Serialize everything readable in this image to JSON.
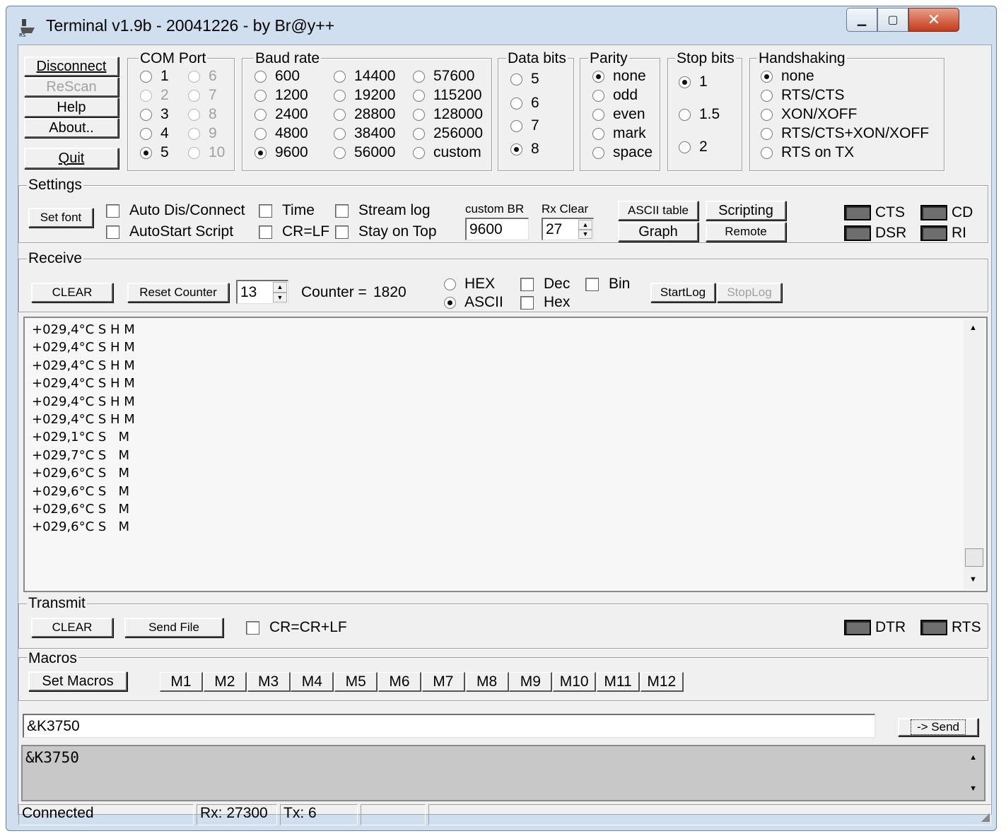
{
  "window": {
    "title": "Terminal v1.9b - 20041226 - by Br@y++",
    "minimize": "▁",
    "maximize": "▢",
    "close": "✕"
  },
  "connection_buttons": {
    "disconnect": "Disconnect",
    "rescan": "ReScan",
    "help": "Help",
    "about": "About..",
    "quit": "Quit"
  },
  "com_port": {
    "label": "COM Port",
    "options": [
      "1",
      "2",
      "3",
      "4",
      "5",
      "6",
      "7",
      "8",
      "9",
      "10"
    ],
    "selected": "5"
  },
  "baud_rate": {
    "label": "Baud rate",
    "options": [
      "600",
      "1200",
      "2400",
      "4800",
      "9600",
      "14400",
      "19200",
      "28800",
      "38400",
      "56000",
      "57600",
      "115200",
      "128000",
      "256000",
      "custom"
    ],
    "selected": "9600"
  },
  "data_bits": {
    "label": "Data bits",
    "options": [
      "5",
      "6",
      "7",
      "8"
    ],
    "selected": "8"
  },
  "parity": {
    "label": "Parity",
    "options": [
      "none",
      "odd",
      "even",
      "mark",
      "space"
    ],
    "selected": "none"
  },
  "stop_bits": {
    "label": "Stop bits",
    "options": [
      "1",
      "1.5",
      "2"
    ],
    "selected": "1"
  },
  "handshaking": {
    "label": "Handshaking",
    "options": [
      "none",
      "RTS/CTS",
      "XON/XOFF",
      "RTS/CTS+XON/XOFF",
      "RTS on TX"
    ],
    "selected": "none"
  },
  "settings": {
    "label": "Settings",
    "set_font": "Set font",
    "auto_dis_connect": "Auto Dis/Connect",
    "autostart_script": "AutoStart Script",
    "time": "Time",
    "cr_lf": "CR=LF",
    "stream_log": "Stream log",
    "stay_on_top": "Stay on Top",
    "custom_br_label": "custom BR",
    "custom_br_value": "9600",
    "rx_clear_label": "Rx Clear",
    "rx_clear_value": "27",
    "ascii_table": "ASCII table",
    "scripting": "Scripting",
    "graph": "Graph",
    "remote": "Remote",
    "leds": {
      "cts": "CTS",
      "cd": "CD",
      "dsr": "DSR",
      "ri": "RI"
    }
  },
  "receive": {
    "label": "Receive",
    "clear": "CLEAR",
    "reset_counter": "Reset Counter",
    "counter_spin": "13",
    "counter_label": "Counter =",
    "counter_value": "1820",
    "hex": "HEX",
    "ascii": "ASCII",
    "mode_selected": "ASCII",
    "dec": "Dec",
    "bin": "Bin",
    "hex_check": "Hex",
    "start_log": "StartLog",
    "stop_log": "StopLog",
    "lines": [
      "+029,4°C S H M",
      "+029,4°C S H M",
      "+029,4°C S H M",
      "+029,4°C S H M",
      "+029,4°C S H M",
      "+029,4°C S H M",
      "+029,1°C S   M",
      "+029,7°C S   M",
      "+029,6°C S   M",
      "+029,6°C S   M",
      "+029,6°C S   M",
      "+029,6°C S   M"
    ]
  },
  "transmit": {
    "label": "Transmit",
    "clear": "CLEAR",
    "send_file": "Send File",
    "cr_crlf": "CR=CR+LF",
    "leds": {
      "dtr": "DTR",
      "rts": "RTS"
    }
  },
  "macros": {
    "label": "Macros",
    "set_macros": "Set Macros",
    "buttons": [
      "M1",
      "M2",
      "M3",
      "M4",
      "M5",
      "M6",
      "M7",
      "M8",
      "M9",
      "M10",
      "M11",
      "M12"
    ]
  },
  "send": {
    "input_value": "&K3750",
    "send_button": "-> Send",
    "log_text": "&K3750"
  },
  "status": {
    "state": "Connected",
    "rx": "Rx: 27300",
    "tx": "Tx: 6"
  }
}
